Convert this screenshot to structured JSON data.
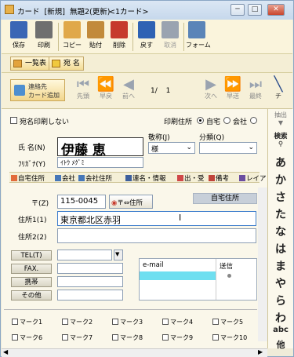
{
  "window": {
    "title": "カード  [新規]  無題2(更新)",
    "subtitle": "<1カード>",
    "min": "─",
    "max": "□",
    "close": "✕"
  },
  "toolbar": [
    {
      "label": "保存",
      "icon": "save-icon",
      "color": "#3a66b5"
    },
    {
      "label": "印刷",
      "icon": "print-icon",
      "color": "#6f6f6f"
    },
    {
      "label": "コピー",
      "icon": "copy-icon",
      "color": "#e0a84a"
    },
    {
      "label": "貼付",
      "icon": "paste-icon",
      "color": "#c28a3b"
    },
    {
      "label": "削除",
      "icon": "delete-icon",
      "color": "#c63a2d"
    },
    {
      "label": "戻す",
      "icon": "undo-icon",
      "color": "#2f62b4"
    },
    {
      "label": "取消",
      "icon": "redo-icon",
      "color": "#9aa3b0"
    },
    {
      "label": "フォーム",
      "icon": "form-icon",
      "color": "#5a84b8"
    }
  ],
  "views": {
    "list": "一覧表",
    "address": "宛 名"
  },
  "nav": {
    "add": "連絡先\nカード追加",
    "first": "先頭",
    "fastprev": "早戻",
    "prev": "前へ",
    "page": "1/ 1",
    "next": "次へ",
    "fastnext": "早送",
    "last": "最終",
    "more": "チ"
  },
  "side": {
    "extract": "抽出",
    "search": "検索",
    "kana": [
      "あ",
      "か",
      "さ",
      "た",
      "な",
      "は",
      "ま",
      "や",
      "ら",
      "わ"
    ],
    "abc": "abc",
    "other": "他"
  },
  "form": {
    "no_print": "宛名印刷しない",
    "print_addr": "印刷住所",
    "home": "自宅",
    "company": "会社",
    "name_label": "氏 名(N)",
    "name": "伊藤 恵",
    "kana_label": "ﾌﾘｶﾞﾅ(Y)",
    "kana": "ｲﾄｳ ﾒｸﾞﾐ",
    "honorific_label": "敬称(J)",
    "honorific": "様",
    "category_label": "分類(Q)",
    "tabs": [
      "自宅住所",
      "会社",
      "会社住所",
      "連名・情報",
      "出・受",
      "備考",
      "レイア"
    ],
    "zip_label": "〒(Z)",
    "zip": "115-0045",
    "zipconv": "〒⇔住所",
    "addr_type": "自宅住所",
    "addr1_label": "住所1(1)",
    "addr1": "東京都北区赤羽",
    "addr2_label": "住所2(2)",
    "addr2": "",
    "tel": "TEL(T)",
    "fax": "FAX.",
    "mobile": "携帯",
    "other": "その他",
    "email_head": "e-mail",
    "send_head": "送信"
  },
  "marks": [
    "マーク1",
    "マーク2",
    "マーク3",
    "マーク4",
    "マーク5",
    "マーク6",
    "マーク7",
    "マーク8",
    "マーク9",
    "マーク10"
  ]
}
